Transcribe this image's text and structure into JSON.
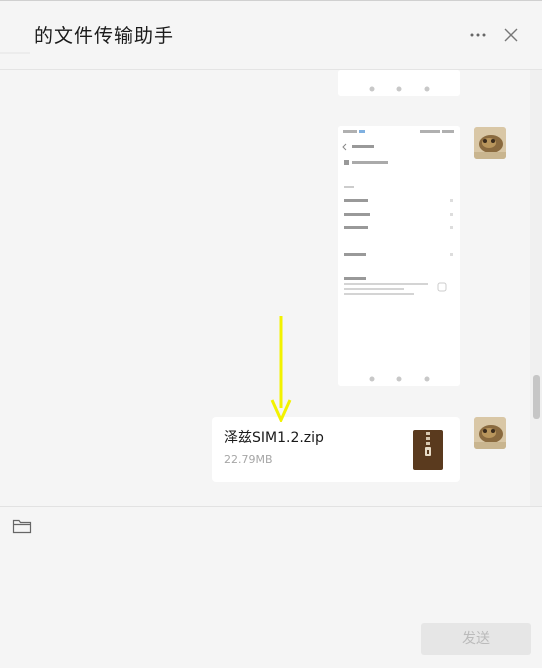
{
  "window": {
    "title": "的文件传输助手",
    "more_icon": "more-dots-icon",
    "close_icon": "close-icon"
  },
  "messages": [
    {
      "type": "image",
      "content": "phone-screenshot",
      "partial": true
    },
    {
      "type": "image",
      "content": "phone-screenshot"
    },
    {
      "type": "file",
      "file_name": "泽兹SIM1.2.zip",
      "file_size": "22.79MB",
      "icon": "zip-archive-icon"
    }
  ],
  "annotation": {
    "type": "arrow",
    "color": "#f2f200"
  },
  "input": {
    "folder_icon": "folder-icon",
    "send_label": "发送"
  },
  "colors": {
    "background": "#f5f5f5",
    "card": "#ffffff",
    "send_disabled_bg": "#e6e6e6",
    "send_disabled_text": "#bbbbbb",
    "zip_icon": "#5a3a1e"
  }
}
